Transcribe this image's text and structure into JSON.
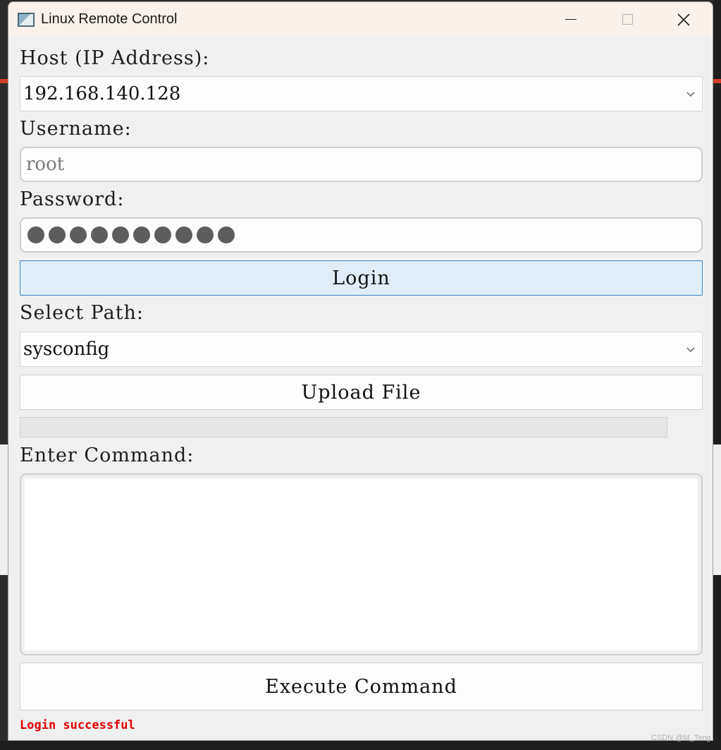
{
  "window": {
    "title": "Linux Remote Control"
  },
  "host": {
    "label": "Host (IP Address):",
    "value": "192.168.140.128"
  },
  "username": {
    "label": "Username:",
    "placeholder": "root"
  },
  "password": {
    "label": "Password:",
    "masked_length": 10
  },
  "login": {
    "label": "Login"
  },
  "path": {
    "label": "Select Path:",
    "value": "sysconfig"
  },
  "upload": {
    "label": "Upload File",
    "progress": 0
  },
  "command": {
    "label": "Enter Command:",
    "value": ""
  },
  "execute": {
    "label": "Execute Command"
  },
  "status": {
    "text": "Login successful",
    "color": "#e00000"
  },
  "watermark": "CSDN @M_Teng",
  "colors": {
    "accent_border": "#3b84c9",
    "accent_fill": "#e0edf9",
    "titlebar": "#f9f1ea"
  }
}
